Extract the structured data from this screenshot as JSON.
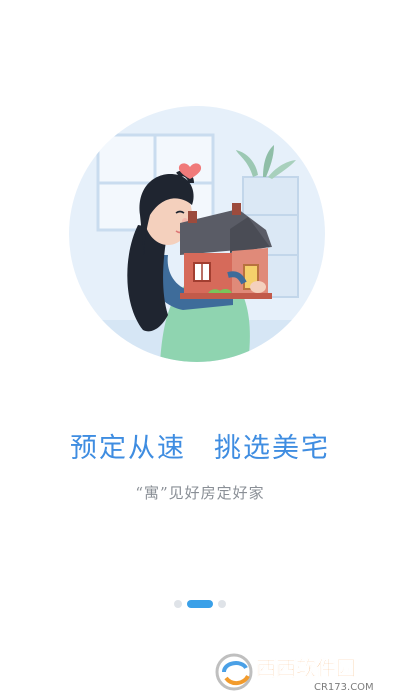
{
  "onboarding": {
    "headline_left": "预定从速",
    "headline_right": "挑选美宅",
    "subline": "“寓”见好房定好家",
    "pagination": {
      "total": 3,
      "active_index": 1
    }
  },
  "watermark": {
    "brand": "西西软件园",
    "url": "CR173.COM"
  },
  "colors": {
    "accent": "#3f8de1",
    "dot_active": "#3aa0e8",
    "dot_inactive": "#dfe3e8",
    "subtext": "#8a8f96",
    "circle_bg": "#e6f0fa"
  },
  "icons": {
    "illustration": "woman-hugging-house-illustration",
    "heart": "heart-icon",
    "watermark_logo": "cr173-logo-icon"
  }
}
